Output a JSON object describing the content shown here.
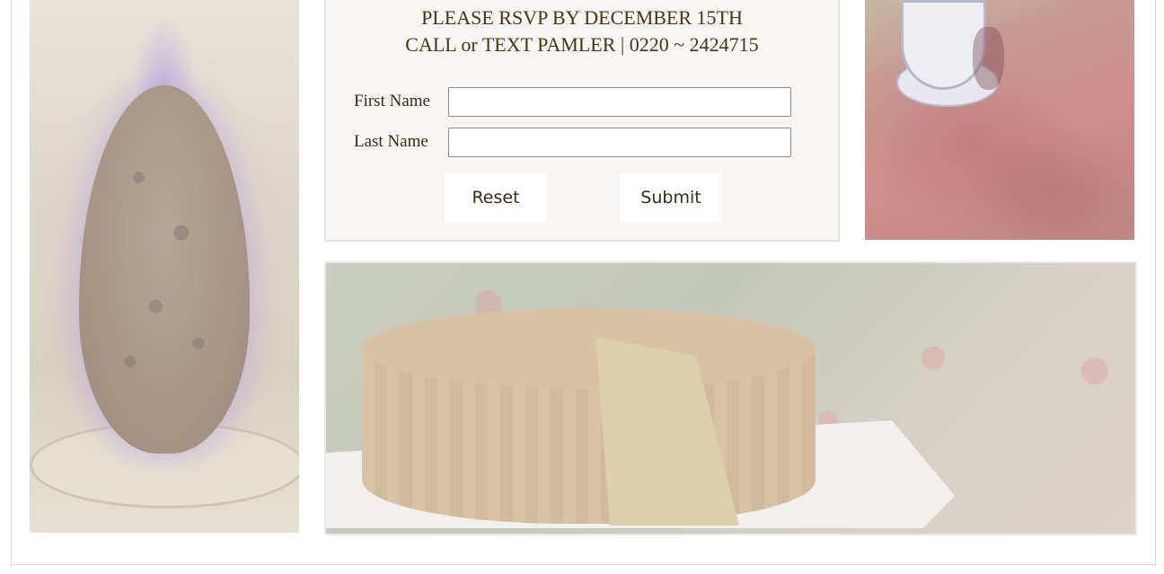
{
  "rsvp": {
    "deadline_line": "PLEASE RSVP BY DECEMBER 15TH",
    "contact_line": "CALL or TEXT PAMLER | 0220 ~ 2424715"
  },
  "form": {
    "first_name_label": "First Name",
    "first_name_value": "",
    "last_name_label": "Last Name",
    "last_name_value": "",
    "reset_label": "Reset",
    "submit_label": "Submit"
  },
  "colors": {
    "heading_text": "#4a3512",
    "card_background": "#f8f5f2"
  }
}
